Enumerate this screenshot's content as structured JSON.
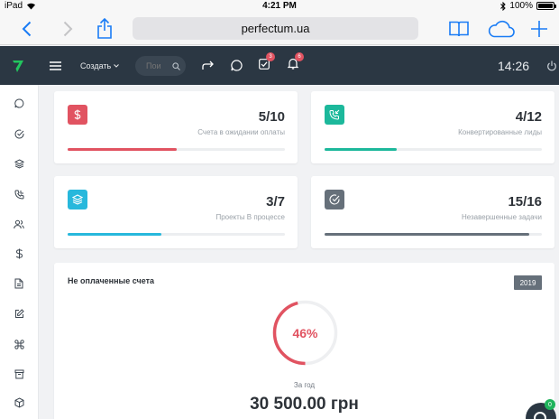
{
  "status_bar": {
    "device": "iPad",
    "time": "4:21 PM",
    "battery": "100%"
  },
  "browser": {
    "url": "perfectum.ua"
  },
  "app_header": {
    "create_label": "Создать",
    "search_placeholder": "Пои",
    "tasks_badge": "3",
    "notifications_badge": "6",
    "clock": "14:26"
  },
  "sidebar": {
    "items": [
      "chat-icon",
      "check-circle-icon",
      "layers-icon",
      "phone-icon",
      "users-icon",
      "dollar-icon",
      "file-icon",
      "edit-icon",
      "command-icon",
      "archive-icon",
      "box-icon"
    ]
  },
  "stats": [
    {
      "value": "5/10",
      "label": "Счета в ожидании оплаты",
      "progress": 0.5,
      "color": "#e15361",
      "icon": "dollar-icon"
    },
    {
      "value": "4/12",
      "label": "Конвертированные лиды",
      "progress": 0.333,
      "color": "#1cb89b",
      "icon": "phone-incoming-icon"
    },
    {
      "value": "3/7",
      "label": "Проекты В процессе",
      "progress": 0.43,
      "color": "#27b8dc",
      "icon": "layers-icon"
    },
    {
      "value": "15/16",
      "label": "Незавершенные задачи",
      "progress": 0.94,
      "color": "#66707a",
      "icon": "check-circle-icon"
    }
  ],
  "unpaid": {
    "title": "Не оплаченные счета",
    "year": "2019",
    "percent_label": "46%",
    "percent": 0.46,
    "period": "За год",
    "amount": "30 500.00 грн"
  },
  "help_badge": "0",
  "colors": {
    "header": "#2b3743",
    "accent_red": "#e15361",
    "accent_green": "#1cb89b",
    "accent_blue": "#27b8dc",
    "gray": "#66707a",
    "ios_blue": "#1a7cf5"
  }
}
